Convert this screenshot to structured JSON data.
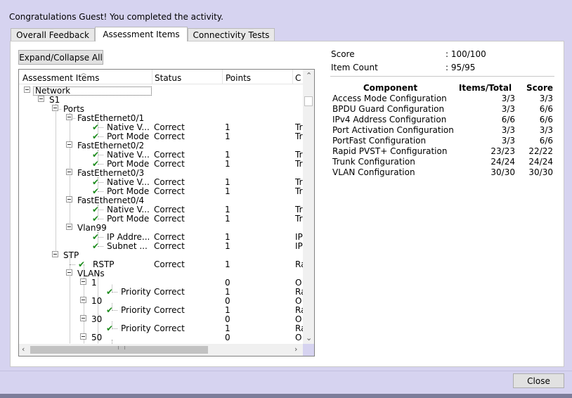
{
  "header": {
    "message": "Congratulations Guest! You completed the activity."
  },
  "tabs": [
    {
      "label": "Overall Feedback"
    },
    {
      "label": "Assessment Items"
    },
    {
      "label": "Connectivity Tests"
    }
  ],
  "toolbar": {
    "expand_label": "Expand/Collapse All"
  },
  "tree": {
    "columns": [
      "Assessment Items",
      "Status",
      "Points",
      "C"
    ],
    "rows": [
      {
        "label": "Network"
      },
      {
        "label": "S1"
      },
      {
        "label": "Ports"
      },
      {
        "label": "FastEthernet0/1"
      },
      {
        "label": "Native V...",
        "status": "Correct",
        "points": "1",
        "c": "Tr"
      },
      {
        "label": "Port Mode",
        "status": "Correct",
        "points": "1",
        "c": "Tr"
      },
      {
        "label": "FastEthernet0/2"
      },
      {
        "label": "Native V...",
        "status": "Correct",
        "points": "1",
        "c": "Tr"
      },
      {
        "label": "Port Mode",
        "status": "Correct",
        "points": "1",
        "c": "Tr"
      },
      {
        "label": "FastEthernet0/3"
      },
      {
        "label": "Native V...",
        "status": "Correct",
        "points": "1",
        "c": "Tr"
      },
      {
        "label": "Port Mode",
        "status": "Correct",
        "points": "1",
        "c": "Tr"
      },
      {
        "label": "FastEthernet0/4"
      },
      {
        "label": "Native V...",
        "status": "Correct",
        "points": "1",
        "c": "Tr"
      },
      {
        "label": "Port Mode",
        "status": "Correct",
        "points": "1",
        "c": "Tr"
      },
      {
        "label": "Vlan99"
      },
      {
        "label": "IP Addre...",
        "status": "Correct",
        "points": "1",
        "c": "IP"
      },
      {
        "label": "Subnet ...",
        "status": "Correct",
        "points": "1",
        "c": "IP"
      },
      {
        "label": "STP"
      },
      {
        "label": "RSTP",
        "status": "Correct",
        "points": "1",
        "c": "Ra"
      },
      {
        "label": "VLANs"
      },
      {
        "label": "1",
        "points": "0",
        "c": "O"
      },
      {
        "label": "Priority",
        "status": "Correct",
        "points": "1",
        "c": "Ra"
      },
      {
        "label": "10",
        "points": "0",
        "c": "O"
      },
      {
        "label": "Priority",
        "status": "Correct",
        "points": "1",
        "c": "Ra"
      },
      {
        "label": "30",
        "points": "0",
        "c": "O"
      },
      {
        "label": "Priority",
        "status": "Correct",
        "points": "1",
        "c": "Ra"
      },
      {
        "label": "50",
        "points": "0",
        "c": "O"
      }
    ]
  },
  "summary": {
    "score_label": "Score",
    "score_value": ": 100/100",
    "count_label": "Item Count",
    "count_value": ": 95/95"
  },
  "components": {
    "headers": [
      "Component",
      "Items/Total",
      "Score"
    ],
    "rows": [
      {
        "name": "Access Mode Configuration",
        "items": "3/3",
        "score": "3/3"
      },
      {
        "name": "BPDU Guard Configuration",
        "items": "3/3",
        "score": "6/6"
      },
      {
        "name": "IPv4 Address Configuration",
        "items": "6/6",
        "score": "6/6"
      },
      {
        "name": "Port Activation Configuration",
        "items": "3/3",
        "score": "3/3"
      },
      {
        "name": "PortFast Configuration",
        "items": "3/3",
        "score": "6/6"
      },
      {
        "name": "Rapid PVST+ Configuration",
        "items": "23/23",
        "score": "22/22"
      },
      {
        "name": "Trunk Configuration",
        "items": "24/24",
        "score": "24/24"
      },
      {
        "name": "VLAN Configuration",
        "items": "30/30",
        "score": "30/30"
      }
    ]
  },
  "footer": {
    "close_label": "Close"
  }
}
